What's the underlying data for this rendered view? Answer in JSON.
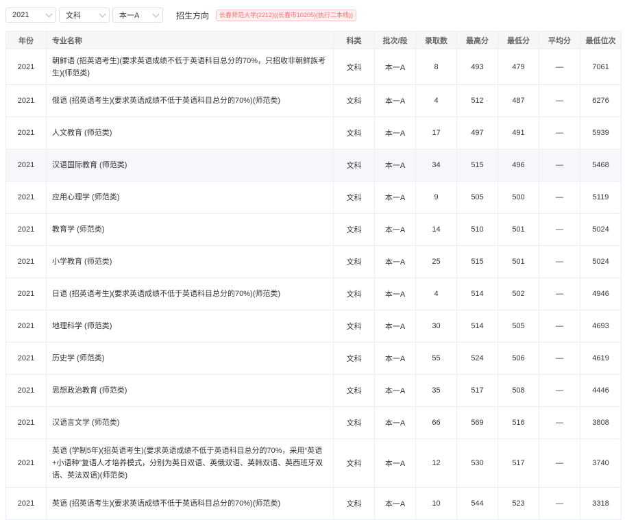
{
  "filters": {
    "year": "2021",
    "subject": "文科",
    "batch": "本一A",
    "direction_label": "招生方向",
    "direction_tag": "长春师范大学(2212)((长春市10205)(执行二本线))"
  },
  "table": {
    "columns": [
      "年份",
      "专业名称",
      "科类",
      "批次/段",
      "录取数",
      "最高分",
      "最低分",
      "平均分",
      "最低位次"
    ],
    "rows": [
      {
        "year": "2021",
        "name": "朝鲜语 (招英语考生)(要求英语成绩不低于英语科目总分的70%，只招收非朝鲜族考生)(师范类)",
        "subject": "文科",
        "batch": "本一A",
        "admitted": "8",
        "max": "493",
        "min": "479",
        "avg": "—",
        "rank": "7061"
      },
      {
        "year": "2021",
        "name": "俄语 (招英语考生)(要求英语成绩不低于英语科目总分的70%)(师范类)",
        "subject": "文科",
        "batch": "本一A",
        "admitted": "4",
        "max": "512",
        "min": "487",
        "avg": "—",
        "rank": "6276"
      },
      {
        "year": "2021",
        "name": "人文教育 (师范类)",
        "subject": "文科",
        "batch": "本一A",
        "admitted": "17",
        "max": "497",
        "min": "491",
        "avg": "—",
        "rank": "5939"
      },
      {
        "year": "2021",
        "name": "汉语国际教育 (师范类)",
        "subject": "文科",
        "batch": "本一A",
        "admitted": "34",
        "max": "515",
        "min": "496",
        "avg": "—",
        "rank": "5468"
      },
      {
        "year": "2021",
        "name": "应用心理学 (师范类)",
        "subject": "文科",
        "batch": "本一A",
        "admitted": "9",
        "max": "505",
        "min": "500",
        "avg": "—",
        "rank": "5119"
      },
      {
        "year": "2021",
        "name": "教育学 (师范类)",
        "subject": "文科",
        "batch": "本一A",
        "admitted": "14",
        "max": "510",
        "min": "501",
        "avg": "—",
        "rank": "5024"
      },
      {
        "year": "2021",
        "name": "小学教育 (师范类)",
        "subject": "文科",
        "batch": "本一A",
        "admitted": "25",
        "max": "515",
        "min": "501",
        "avg": "—",
        "rank": "5024"
      },
      {
        "year": "2021",
        "name": "日语 (招英语考生)(要求英语成绩不低于英语科目总分的70%)(师范类)",
        "subject": "文科",
        "batch": "本一A",
        "admitted": "4",
        "max": "514",
        "min": "502",
        "avg": "—",
        "rank": "4946"
      },
      {
        "year": "2021",
        "name": "地理科学 (师范类)",
        "subject": "文科",
        "batch": "本一A",
        "admitted": "30",
        "max": "514",
        "min": "505",
        "avg": "—",
        "rank": "4693"
      },
      {
        "year": "2021",
        "name": "历史学 (师范类)",
        "subject": "文科",
        "batch": "本一A",
        "admitted": "55",
        "max": "524",
        "min": "506",
        "avg": "—",
        "rank": "4619"
      },
      {
        "year": "2021",
        "name": "思想政治教育 (师范类)",
        "subject": "文科",
        "batch": "本一A",
        "admitted": "35",
        "max": "517",
        "min": "508",
        "avg": "—",
        "rank": "4446"
      },
      {
        "year": "2021",
        "name": "汉语言文学 (师范类)",
        "subject": "文科",
        "batch": "本一A",
        "admitted": "66",
        "max": "569",
        "min": "516",
        "avg": "—",
        "rank": "3808"
      },
      {
        "year": "2021",
        "name": "英语 (学制5年)(招英语考生)(要求英语成绩不低于英语科目总分的70%，采用“英语+小语种”复语人才培养模式，分别为英日双语、英俄双语、英韩双语、英西班牙双语、英法双语)(师范类)",
        "subject": "文科",
        "batch": "本一A",
        "admitted": "12",
        "max": "530",
        "min": "517",
        "avg": "—",
        "rank": "3740"
      },
      {
        "year": "2021",
        "name": "英语 (招英语考生)(要求英语成绩不低于英语科目总分的70%)(师范类)",
        "subject": "文科",
        "batch": "本一A",
        "admitted": "10",
        "max": "544",
        "min": "523",
        "avg": "—",
        "rank": "3318"
      }
    ]
  }
}
